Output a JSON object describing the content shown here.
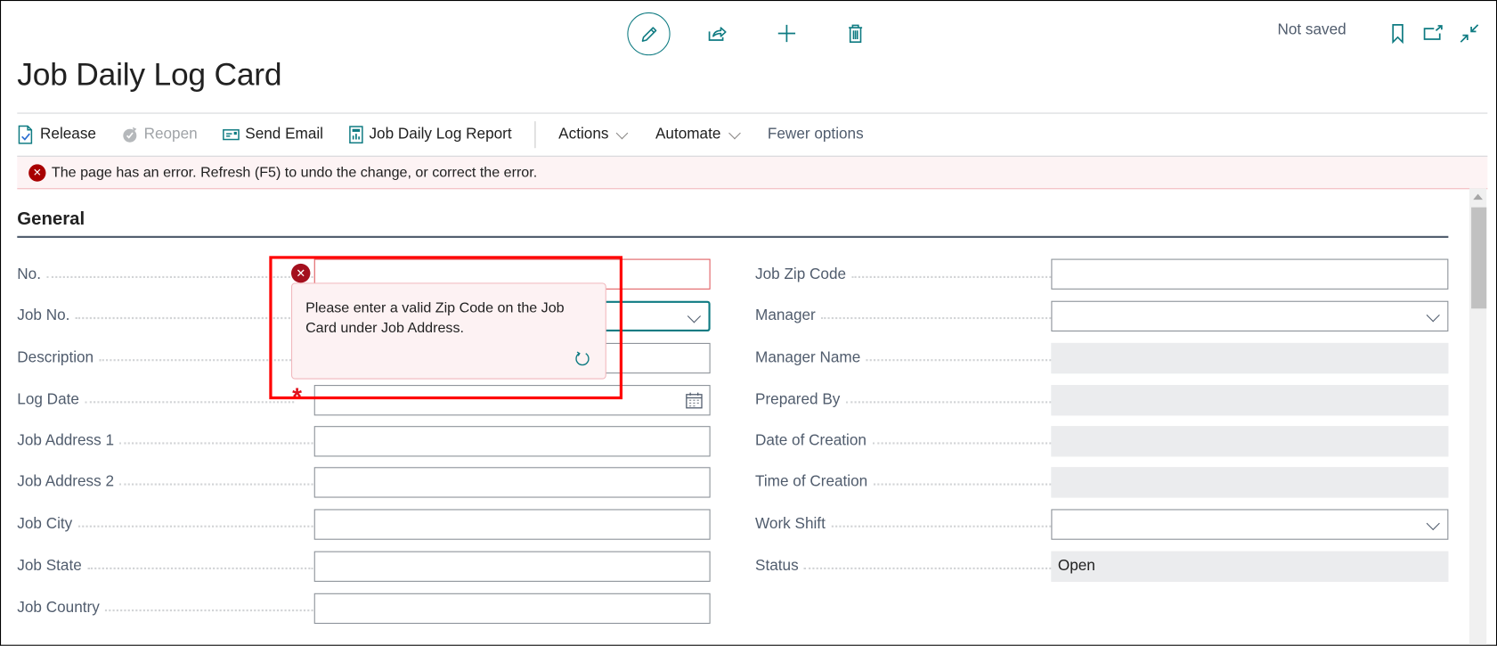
{
  "header": {
    "title": "Job Daily Log Card",
    "save_status": "Not saved",
    "toolbar_icons": [
      {
        "name": "edit-icon",
        "label": "Edit"
      },
      {
        "name": "share-icon",
        "label": "Share"
      },
      {
        "name": "new-icon",
        "label": "New"
      },
      {
        "name": "delete-icon",
        "label": "Delete"
      }
    ],
    "right_icons": [
      {
        "name": "bookmark-icon",
        "label": "Bookmark"
      },
      {
        "name": "open-new-window-icon",
        "label": "Open in new window"
      },
      {
        "name": "collapse-icon",
        "label": "Collapse"
      }
    ]
  },
  "actions": {
    "release": "Release",
    "reopen": "Reopen",
    "send_email": "Send Email",
    "report": "Job Daily Log Report",
    "actions_menu": "Actions",
    "automate_menu": "Automate",
    "fewer_options": "Fewer options"
  },
  "error_banner": {
    "message": "The page has an error. Refresh (F5) to undo the change, or correct the error."
  },
  "section": {
    "title": "General"
  },
  "left_fields": [
    {
      "label": "No.",
      "value": "",
      "type": "text",
      "state": "error"
    },
    {
      "label": "Job No.",
      "value": "",
      "type": "dropdown",
      "state": "focus"
    },
    {
      "label": "Description",
      "value": "",
      "type": "text"
    },
    {
      "label": "Log Date",
      "value": "",
      "type": "date",
      "required": true
    },
    {
      "label": "Job Address 1",
      "value": "",
      "type": "text"
    },
    {
      "label": "Job Address 2",
      "value": "",
      "type": "text"
    },
    {
      "label": "Job City",
      "value": "",
      "type": "text"
    },
    {
      "label": "Job State",
      "value": "",
      "type": "text"
    },
    {
      "label": "Job Country",
      "value": "",
      "type": "text"
    }
  ],
  "right_fields": [
    {
      "label": "Job Zip Code",
      "value": "",
      "type": "text"
    },
    {
      "label": "Manager",
      "value": "",
      "type": "dropdown"
    },
    {
      "label": "Manager Name",
      "value": "",
      "type": "readonly"
    },
    {
      "label": "Prepared By",
      "value": "",
      "type": "readonly"
    },
    {
      "label": "Date of Creation",
      "value": "",
      "type": "readonly"
    },
    {
      "label": "Time of Creation",
      "value": "",
      "type": "readonly"
    },
    {
      "label": "Work Shift",
      "value": "",
      "type": "dropdown"
    },
    {
      "label": "Status",
      "value": "Open",
      "type": "readonly"
    }
  ],
  "validation_tooltip": {
    "message": "Please enter a valid Zip Code on the Job Card under Job Address.",
    "required_marker": "*"
  },
  "colors": {
    "accent": "#0f7b82",
    "error": "#a4101e",
    "error_banner_bg": "#fdf3f4",
    "annotation_box": "#ff0000"
  }
}
